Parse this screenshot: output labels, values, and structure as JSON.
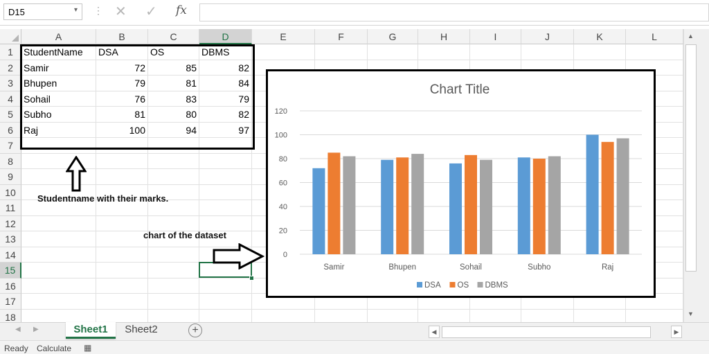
{
  "name_box": {
    "value": "D15"
  },
  "formula_bar": {
    "value": "",
    "fx_label": "fx"
  },
  "columns": [
    "A",
    "B",
    "C",
    "D",
    "E",
    "F",
    "G",
    "H",
    "I",
    "J",
    "K",
    "L"
  ],
  "selected_column": "D",
  "rows": [
    "1",
    "2",
    "3",
    "4",
    "5",
    "6",
    "7",
    "8",
    "9",
    "10",
    "11",
    "12",
    "13",
    "14",
    "15",
    "16",
    "17",
    "18"
  ],
  "selected_row": "15",
  "sheet": {
    "header": [
      "StudentName",
      "DSA",
      "OS",
      "DBMS"
    ],
    "data": [
      [
        "Samir",
        "72",
        "85",
        "82"
      ],
      [
        "Bhupen",
        "79",
        "81",
        "84"
      ],
      [
        "Sohail",
        "76",
        "83",
        "79"
      ],
      [
        "Subho",
        "81",
        "80",
        "82"
      ],
      [
        "Raj",
        "100",
        "94",
        "97"
      ]
    ]
  },
  "annotations": {
    "data_note": "Studentname with their marks.",
    "chart_note": "chart of the dataset"
  },
  "chart_data": {
    "type": "bar",
    "title": "Chart Title",
    "categories": [
      "Samir",
      "Bhupen",
      "Sohail",
      "Subho",
      "Raj"
    ],
    "series": [
      {
        "name": "DSA",
        "values": [
          72,
          79,
          76,
          81,
          100
        ],
        "color": "#5b9bd5"
      },
      {
        "name": "OS",
        "values": [
          85,
          81,
          83,
          80,
          94
        ],
        "color": "#ed7d31"
      },
      {
        "name": "DBMS",
        "values": [
          82,
          84,
          79,
          82,
          97
        ],
        "color": "#a5a5a5"
      }
    ],
    "ylim": [
      0,
      120
    ],
    "yticks": [
      0,
      20,
      40,
      60,
      80,
      100,
      120
    ],
    "grid": true,
    "legend_position": "bottom"
  },
  "tabs": [
    {
      "label": "Sheet1",
      "active": true
    },
    {
      "label": "Sheet2",
      "active": false
    }
  ],
  "status": {
    "ready": "Ready",
    "calculate": "Calculate"
  },
  "colors": {
    "excel_green": "#217346"
  }
}
